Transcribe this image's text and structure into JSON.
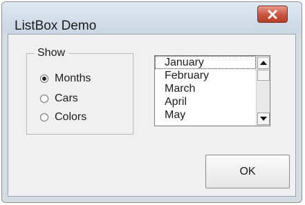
{
  "window": {
    "title": "ListBox Demo"
  },
  "group": {
    "legend": "Show",
    "options": [
      {
        "label": "Months",
        "checked": true
      },
      {
        "label": "Cars",
        "checked": false
      },
      {
        "label": "Colors",
        "checked": false
      }
    ]
  },
  "listbox": {
    "items": [
      "January",
      "February",
      "March",
      "April",
      "May"
    ],
    "focused_index": 0
  },
  "buttons": {
    "ok_label": "OK"
  },
  "icons": {
    "close": "close-icon",
    "scroll_up": "arrow-up-icon",
    "scroll_down": "arrow-down-icon"
  },
  "colors": {
    "close_button": "#c8553f",
    "client_background": "#f0f0f0"
  }
}
